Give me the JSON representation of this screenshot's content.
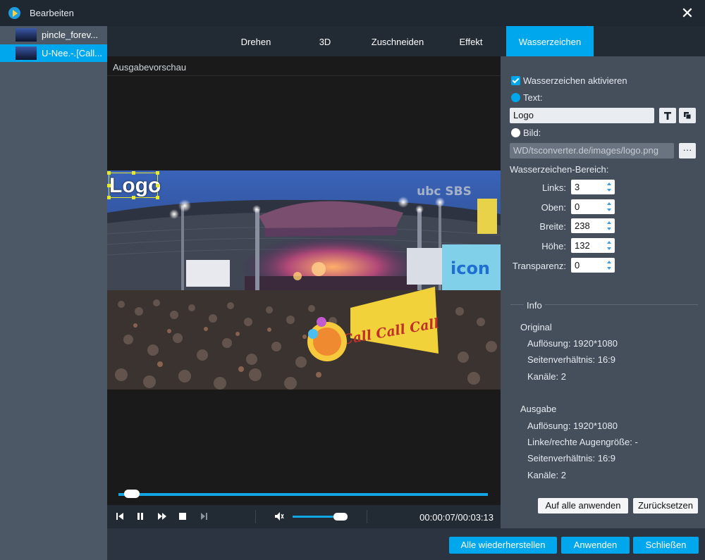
{
  "window": {
    "title": "Bearbeiten"
  },
  "files": [
    {
      "name": "pincle_forev..."
    },
    {
      "name": "U-Nee.-.[Call..."
    }
  ],
  "tabs": [
    "Drehen",
    "3D",
    "Zuschneiden",
    "Effekt",
    "Wasserzeichen"
  ],
  "active_tab": "Wasserzeichen",
  "preview": {
    "label": "Ausgabevorschau",
    "watermark_text": "Logo",
    "broadcaster_logo": "ubc SBS",
    "stage_banner": "icon",
    "overlay_text": "Call Call Call"
  },
  "player": {
    "timecode": "00:00:07/00:03:13",
    "progress": 0.037,
    "volume": 0.9
  },
  "watermark": {
    "enable_label": "Wasserzeichen aktivieren",
    "text_label": "Text:",
    "text_value": "Logo",
    "image_label": "Bild:",
    "image_path": "WD/tsconverter.de/images/logo.png",
    "browse_label": "···",
    "area_label": "Wasserzeichen-Bereich:",
    "left_label": "Links:",
    "left_value": "3",
    "top_label": "Oben:",
    "top_value": "0",
    "width_label": "Breite:",
    "width_value": "238",
    "height_label": "Höhe:",
    "height_value": "132",
    "transparency_label": "Transparenz:",
    "transparency_value": "0"
  },
  "info": {
    "heading": "Info",
    "original_heading": "Original",
    "orig_resolution": "Auflösung: 1920*1080",
    "orig_aspect": "Seitenverhältnis: 16:9",
    "orig_channels": "Kanäle: 2",
    "output_heading": "Ausgabe",
    "out_resolution": "Auflösung: 1920*1080",
    "out_eye": "Linke/rechte Augengröße: -",
    "out_aspect": "Seitenverhältnis: 16:9",
    "out_channels": "Kanäle: 2"
  },
  "buttons": {
    "apply_all": "Auf alle anwenden",
    "reset": "Zurücksetzen",
    "restore_all": "Alle wiederherstellen",
    "apply": "Anwenden",
    "close": "Schließen"
  },
  "colors": {
    "accent": "#00a7ec",
    "watermark_frame": "#e8e82a"
  }
}
